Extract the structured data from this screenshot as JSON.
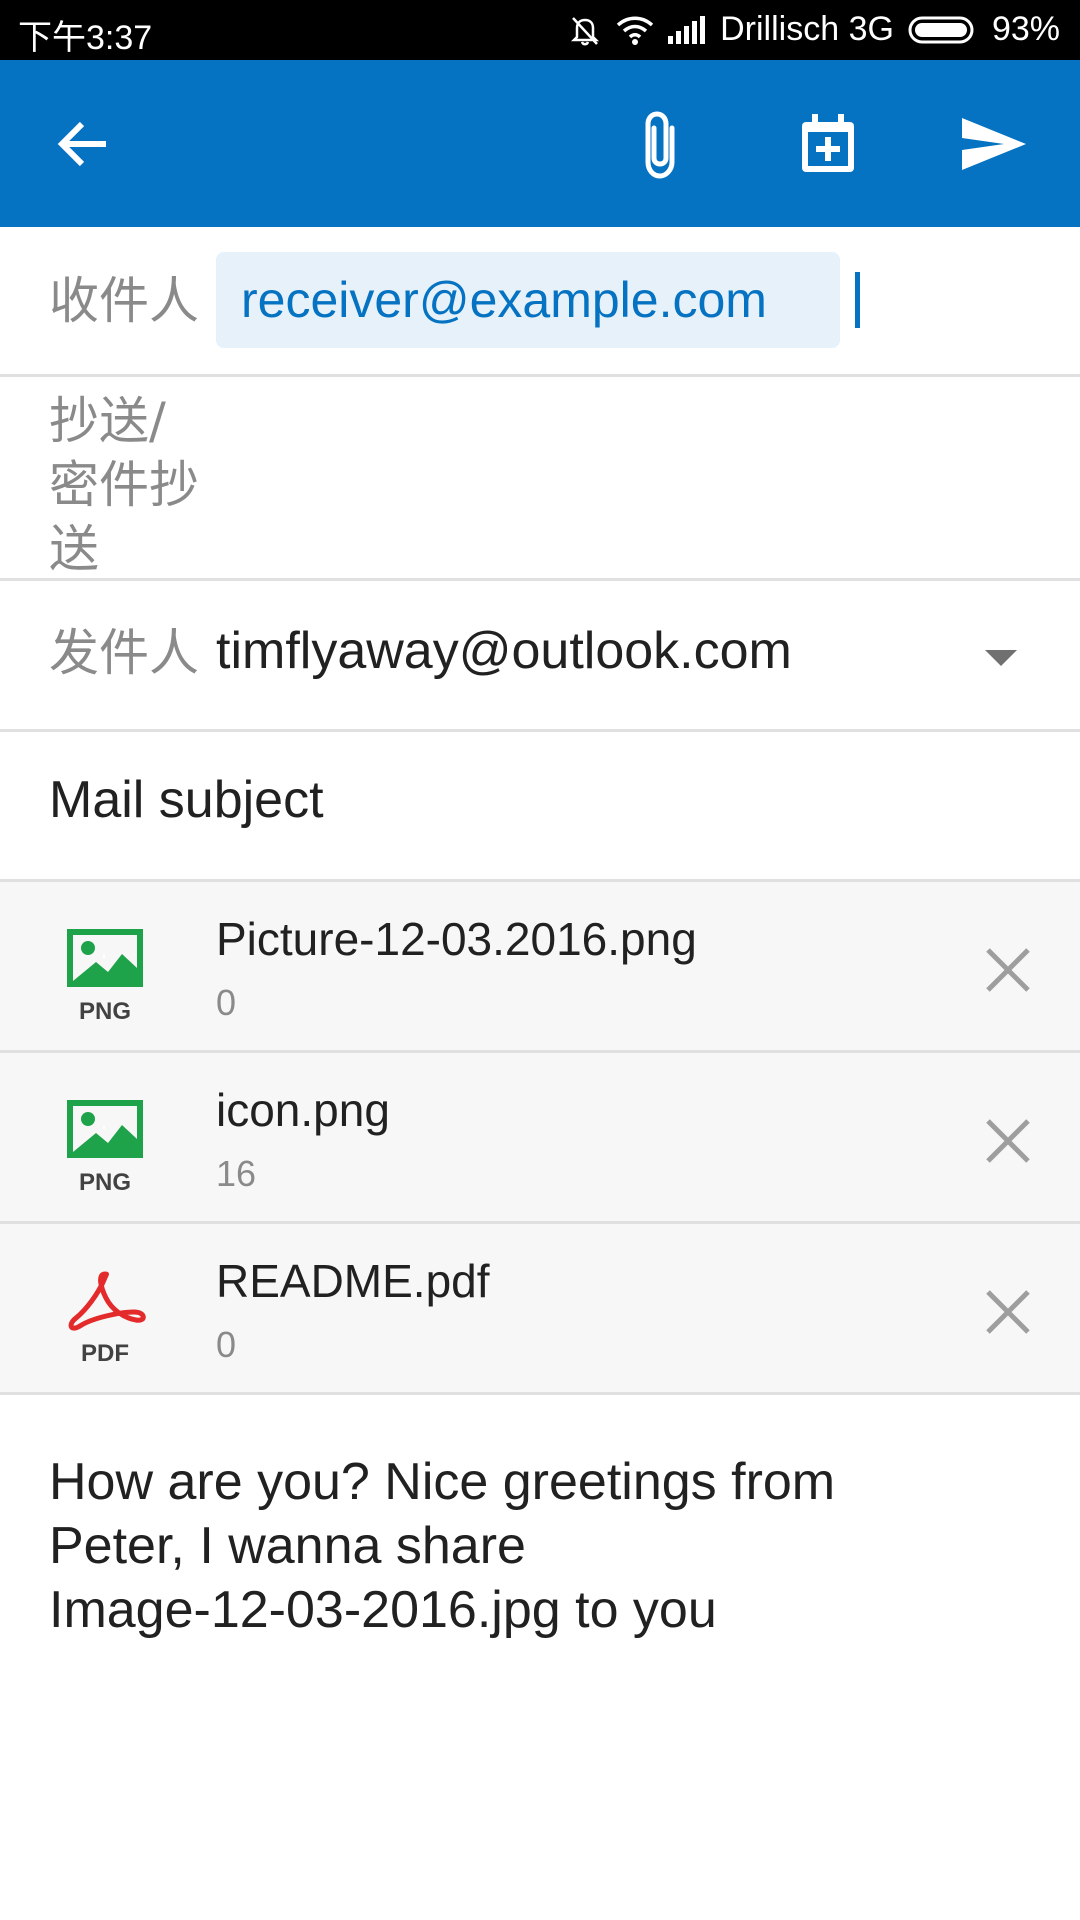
{
  "status_bar": {
    "time": "下午3:37",
    "carrier": "Drillisch 3G",
    "battery": "93%",
    "icons": [
      "bell-muted-icon",
      "wifi-icon",
      "signal-icon",
      "battery-icon"
    ]
  },
  "app_bar": {
    "color": "#0572c2",
    "icons": [
      "back-arrow-icon",
      "attach-icon",
      "calendar-add-icon",
      "send-icon"
    ]
  },
  "compose": {
    "to_label": "收件人",
    "to_recipient": "receiver@example.com",
    "cc_label_lines": [
      "抄送/",
      "密件抄",
      "送"
    ],
    "from_label": "发件人",
    "from_value": "timflyaway@outlook.com",
    "subject": "Mail subject",
    "attachments": [
      {
        "name": "Picture-12-03.2016.png",
        "size": "0",
        "type": "PNG"
      },
      {
        "name": "icon.png",
        "size": "16",
        "type": "PNG"
      },
      {
        "name": "README.pdf",
        "size": "0",
        "type": "PDF"
      }
    ],
    "body": "How are you? Nice greetings from\nPeter, I wanna share\nImage-12-03-2016.jpg to you"
  },
  "colors": {
    "accent": "#0572c2",
    "chip_background": "#e6f1fa",
    "png_icon": "#1fa34a",
    "pdf_icon": "#e32b2b"
  }
}
